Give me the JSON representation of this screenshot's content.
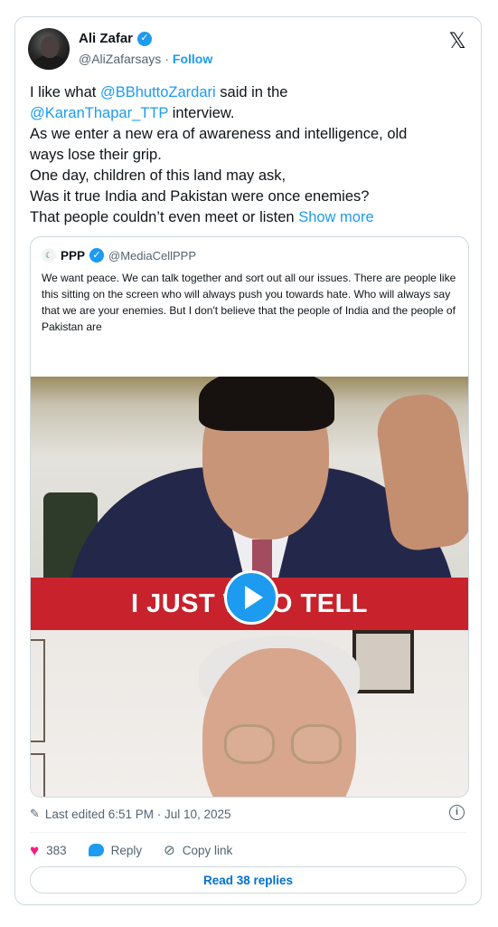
{
  "author": {
    "display_name": "Ali Zafar",
    "handle": "@AliZafarsays",
    "separator": "·",
    "follow_label": "Follow"
  },
  "tweet": {
    "line1_pre": "I like what ",
    "line1_mention": "@BBhuttoZardari",
    "line1_post": " said in the",
    "line2_mention": "@KaranThapar_TTP",
    "line2_post": " interview.",
    "line3": "As we enter a new era of awareness and intelligence, old",
    "line4": "ways lose their grip.",
    "line5": "One day, children of this land may ask,",
    "line6": "Was it true India and Pakistan were once enemies?",
    "line7": "That people couldn’t even meet or listen ",
    "show_more": "Show more"
  },
  "quote": {
    "name": "PPP",
    "handle": "@MediaCellPPP",
    "avatar_glyph": "☾",
    "text": "We want peace. We can talk together and sort out all our issues. There are people like this sitting on the screen who will always push you towards hate. Who will always say that we are your enemies. But I don't believe that the people of India and the people of Pakistan are",
    "video_caption": "I JUST W    TO TELL"
  },
  "meta": {
    "edited_text": "Last edited 6:51 PM · Jul 10, 2025"
  },
  "actions": {
    "likes": "383",
    "reply_label": "Reply",
    "copy_link_label": "Copy link",
    "read_replies_label": "Read 38 replies"
  },
  "icons": {
    "verified": "verified-badge",
    "x_logo": "x-logo",
    "play": "play-icon",
    "heart": "heart-icon",
    "reply": "reply-icon",
    "link": "link-icon",
    "pencil": "pencil-icon",
    "info": "info-icon"
  },
  "colors": {
    "accent": "#1d9bf0",
    "like": "#f91880",
    "banner": "#c8222c",
    "text_secondary": "#536471"
  }
}
